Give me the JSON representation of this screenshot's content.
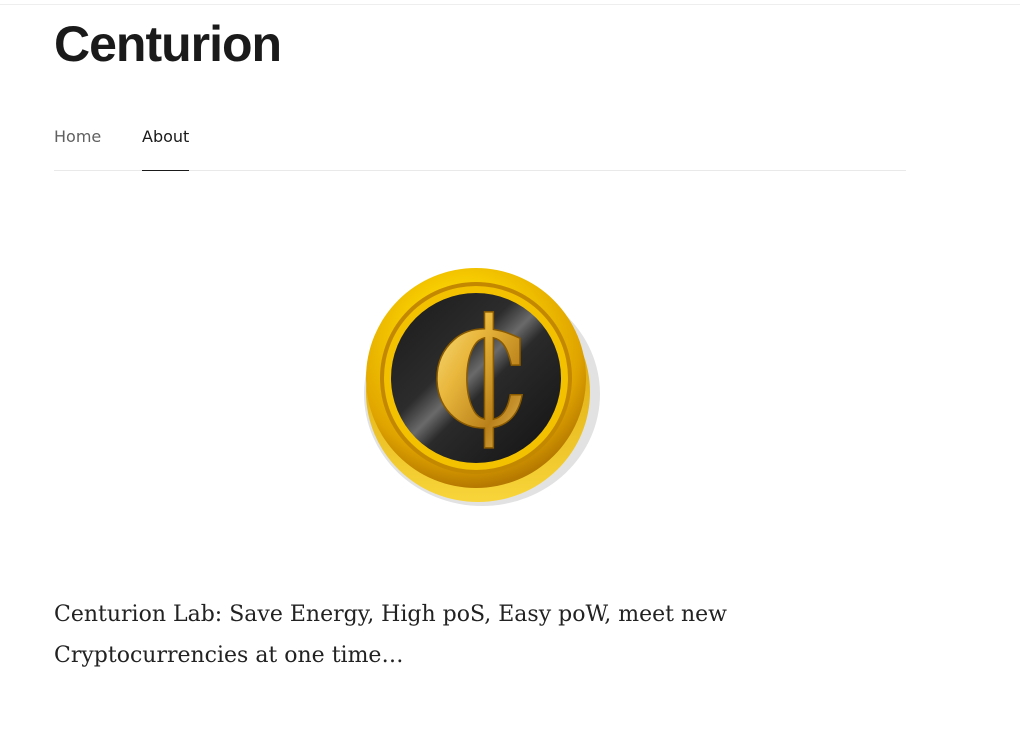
{
  "site": {
    "title": "Centurion"
  },
  "nav": {
    "items": [
      {
        "label": "Home",
        "active": false
      },
      {
        "label": "About",
        "active": true
      }
    ]
  },
  "hero": {
    "icon": "centurion-coin-icon",
    "symbol": "₵",
    "colors": {
      "gold": "#f4c000",
      "coin_face": "#1c1c1c"
    }
  },
  "content": {
    "paragraph": "Centurion Lab: Save Energy, High poS, Easy poW, meet new Cryptocurrencies at one time…"
  }
}
